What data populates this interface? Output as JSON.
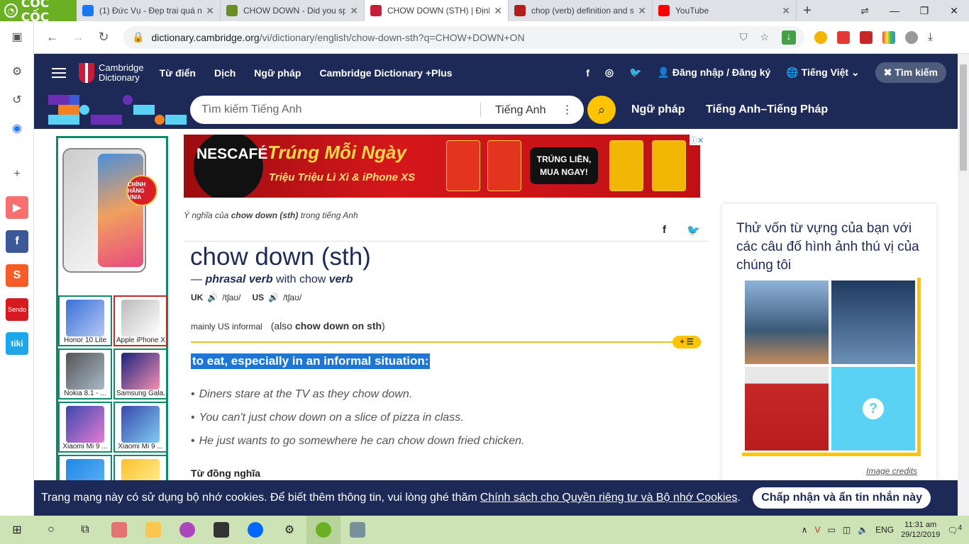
{
  "browser": {
    "brand": "CỐC CỐC",
    "tabs": [
      {
        "title": "(1) Đức Vụ - Đẹp trai quá nè",
        "color": "#1877f2"
      },
      {
        "title": "CHOW DOWN - Did you sp",
        "color": "#6b8e23"
      },
      {
        "title": "CHOW DOWN (STH) | Định",
        "color": "#c41e3a"
      },
      {
        "title": "chop (verb) definition and s",
        "color": "#b71c1c"
      },
      {
        "title": "YouTube",
        "color": "#ff0000"
      }
    ],
    "url_host": "dictionary.cambridge.org",
    "url_path": "/vi/dictionary/english/chow-down-sth?q=CHOW+DOWN+ON"
  },
  "nav": {
    "logo_line1": "Cambridge",
    "logo_line2": "Dictionary",
    "items": [
      "Từ điển",
      "Dịch",
      "Ngữ pháp",
      "Cambridge Dictionary +Plus"
    ],
    "login": "Đăng nhập / Đăng ký",
    "language": "Tiếng Việt",
    "search": "Tìm kiếm"
  },
  "search": {
    "placeholder": "Tìm kiếm Tiếng Anh",
    "lang": "Tiếng Anh",
    "link1": "Ngữ pháp",
    "link2": "Tiếng Anh–Tiếng Pháp"
  },
  "leftad": {
    "badge": "CHÍNH HÃNG VN/A",
    "products": [
      "Honor 10 Lite",
      "Apple iPhone X",
      "Nokia 8.1 - ...",
      "Samsung Gala...",
      "Xiaomi Mi 9 ...",
      "Xiaomi Mi 9 ...",
      "",
      ""
    ]
  },
  "banner": {
    "brand": "NESCAFÉ",
    "title": "Trúng Mỗi Ngày",
    "subtitle": "Triệu Triệu Lì Xì & iPhone XS",
    "cta": "TRÚNG LIỀN, MUA NGAY!"
  },
  "entry": {
    "crumb_pre": "Ý nghĩa của ",
    "crumb_word": "chow down (sth)",
    "crumb_post": " trong tiếng Anh",
    "headword": "chow down (sth)",
    "pos_prefix": "— ",
    "pos": "phrasal verb",
    "pos_with": " with chow ",
    "pos_verb": "verb",
    "uk": "UK",
    "us": "US",
    "ipa_uk": "/tʃaʊ/",
    "ipa_us": "/tʃaʊ/",
    "grammar": "mainly US informal",
    "also_pre": "(also ",
    "also_word": "chow down on sth",
    "also_post": ")",
    "definition": "to eat, especially in an informal situation:",
    "examples": [
      "Diners stare at the TV as they chow down.",
      "You can't just chow down on a slice of pizza in class.",
      "He just wants to go somewhere he can chow down fried chicken."
    ],
    "synonyms_label": "Từ đồng nghĩa"
  },
  "quiz": {
    "title": "Thử vốn từ vựng của bạn với các câu đố hình ảnh thú vị của chúng tôi",
    "credits": "Image credits"
  },
  "cookie": {
    "text": "Trang mạng này có sử dụng bộ nhớ cookies. Để biết thêm thông tin, vui lòng ghé thăm ",
    "link": "Chính sách cho Quyền riêng tư và Bộ nhớ Cookies",
    "end": ".",
    "accept": "Chấp nhận và ẩn tin nhắn này"
  },
  "taskbar": {
    "lang": "ENG",
    "time": "11:31 am",
    "date": "29/12/2019",
    "notif": "4"
  }
}
